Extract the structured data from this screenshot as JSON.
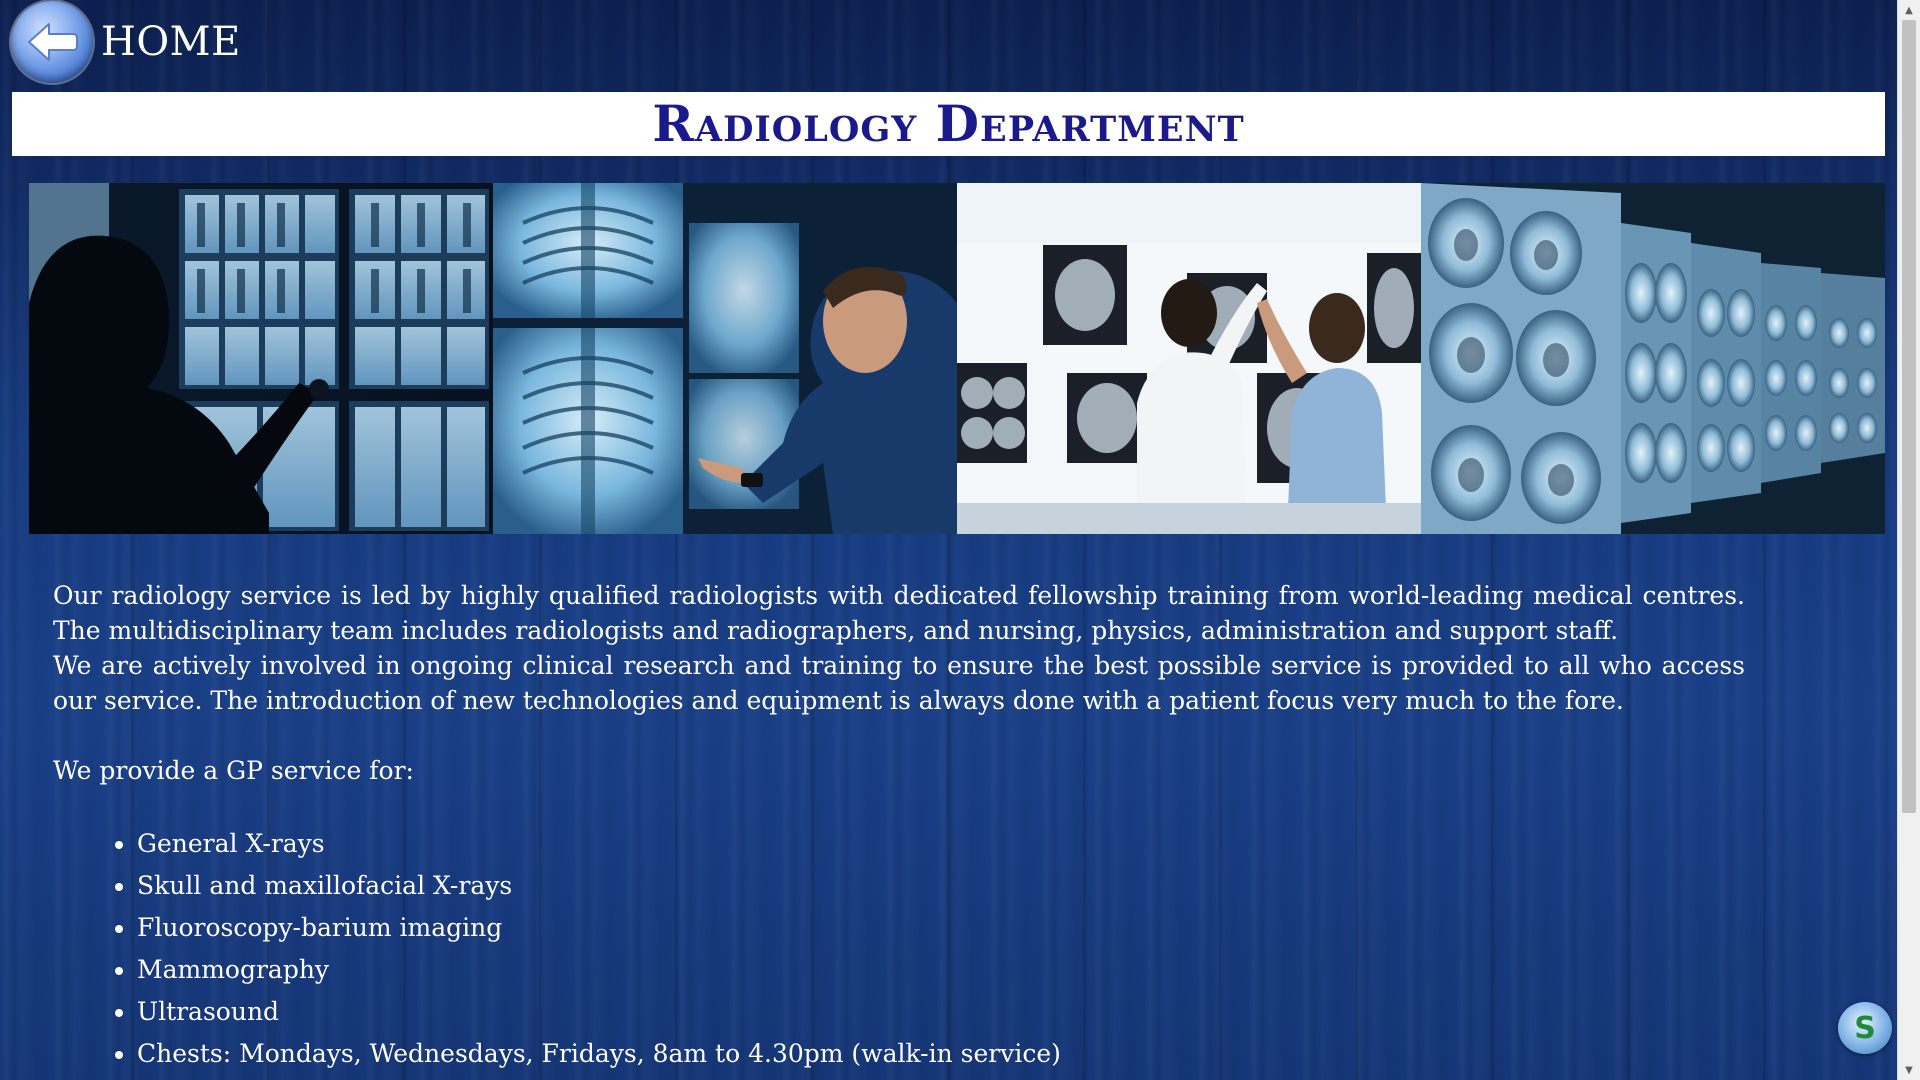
{
  "header": {
    "home_label": "HOME",
    "home_icon": "back-arrow-icon"
  },
  "title": "Radiology Department",
  "banner": {
    "panels": [
      {
        "name": "doctor-pointing-at-spine-xrays",
        "icon": "photo"
      },
      {
        "name": "radiologist-examining-chest-xrays",
        "icon": "photo"
      },
      {
        "name": "two-doctors-reviewing-scans",
        "icon": "photo"
      },
      {
        "name": "brain-mri-scans-wall",
        "icon": "photo"
      }
    ]
  },
  "content": {
    "paragraph_1": "Our radiology service is led by highly qualified radiologists with dedicated fellowship training from world-leading medical centres. The multidisciplinary team includes radiologists and radiographers, and nursing, physics, administration and support staff.",
    "paragraph_2": "We are actively involved in ongoing clinical research and training to ensure the best possible service is provided to all who access our service. The introduction of new technologies and equipment is always done with a patient focus very much to the fore.",
    "gp_heading": "We provide a GP service for:",
    "services": [
      "General X-rays",
      "Skull and maxillofacial X-rays",
      "Fluoroscopy-barium imaging",
      "Mammography",
      "Ultrasound",
      "Chests: Mondays, Wednesdays, Fridays, 8am to 4.30pm (walk-in service)"
    ]
  },
  "colors": {
    "background": "#163a7e",
    "title_bar": "#ffffff",
    "title_text": "#1a1a8c",
    "body_text": "#ffffff"
  },
  "scrollbar": {
    "up_icon": "scroll-up-arrow-icon",
    "down_icon": "scroll-down-arrow-icon"
  },
  "badge": {
    "letter": "S",
    "icon": "floating-app-badge-icon"
  }
}
